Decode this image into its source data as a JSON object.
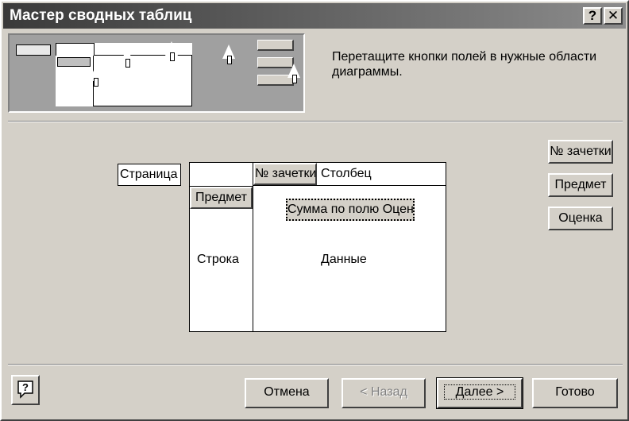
{
  "window": {
    "title": "Мастер сводных таблиц",
    "help_glyph": "?",
    "close_glyph": "✕"
  },
  "instruction": "Перетащите кнопки полей в нужные области диаграммы.",
  "layout": {
    "page_area_label": "Страница",
    "column_area_label": "Столбец",
    "row_area_label": "Строка",
    "data_area_label": "Данные",
    "column_field": "№ зачетки",
    "row_field": "Предмет",
    "data_field": "Сумма по полю Оценка"
  },
  "available_fields": [
    "№ зачетки",
    "Предмет",
    "Оценка"
  ],
  "buttons": {
    "cancel": "Отмена",
    "back": "< Назад",
    "next": "Далее >",
    "finish": "Готово"
  },
  "icons": {
    "help": "help-question-icon",
    "cursor": "pointer-arrow-icon"
  }
}
